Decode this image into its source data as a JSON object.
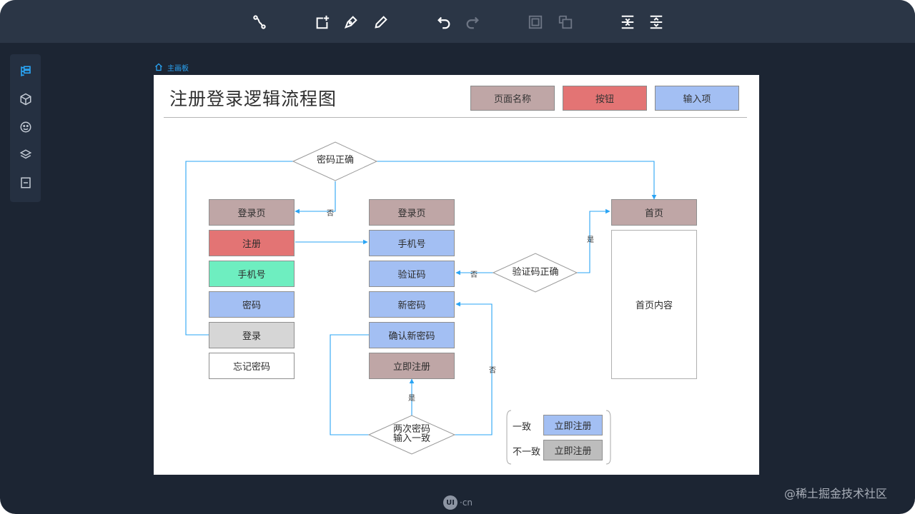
{
  "breadcrumb": {
    "label": "主画板"
  },
  "diagram": {
    "title": "注册登录逻辑流程图",
    "legend": {
      "page_name": "页面名称",
      "button": "按钮",
      "input": "输入项"
    },
    "login_column": {
      "login_page": "登录页",
      "register": "注册",
      "phone": "手机号",
      "password": "密码",
      "login": "登录",
      "forgot_password": "忘记密码"
    },
    "register_column": {
      "login_page": "登录页",
      "phone": "手机号",
      "code": "验证码",
      "new_password": "新密码",
      "confirm_password": "确认新密码",
      "register_now": "立即注册"
    },
    "home_column": {
      "home": "首页",
      "home_content": "首页内容"
    },
    "decisions": {
      "password_correct": "密码正确",
      "code_correct": "验证码正确",
      "match_line1": "两次密码",
      "match_line2": "输入一致"
    },
    "edge_labels": {
      "no": "否",
      "yes": "是"
    },
    "states": {
      "consistent": "一致",
      "inconsistent": "不一致",
      "register_enabled": "立即注册",
      "register_disabled": "立即注册"
    }
  },
  "footer": {
    "logo_mark": "UI",
    "logo_text": "·cn",
    "watermark": "@稀土掘金技术社区"
  },
  "colors": {
    "background": "#1c2533",
    "toolbar": "#2b3646",
    "accent": "#2aa4f4",
    "page_name": "#bfa6a6",
    "button": "#e37474",
    "input": "#a3bff3",
    "connector": "#2aa4f4"
  }
}
